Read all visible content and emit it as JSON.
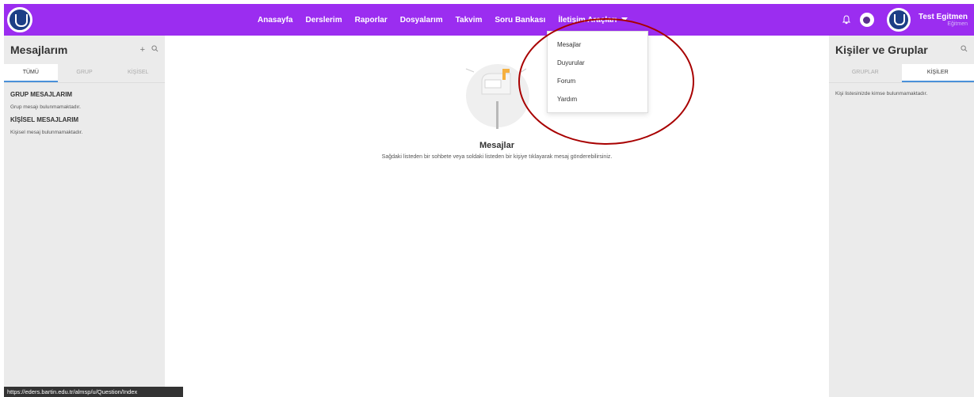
{
  "topbar": {
    "nav": [
      "Anasayfa",
      "Derslerim",
      "Raporlar",
      "Dosyalarım",
      "Takvim",
      "Soru Bankası",
      "İletişim Araçları"
    ],
    "user_name": "Test Egitmen",
    "user_role": "Eğitmen",
    "accent_color": "#9b2df0"
  },
  "left_panel": {
    "title": "Mesajlarım",
    "add_icon": "+",
    "search_icon": "search-icon",
    "tabs": [
      "TÜMÜ",
      "GRUP",
      "KİŞİSEL"
    ],
    "group_heading": "GRUP MESAJLARIM",
    "group_empty": "Grup mesajı bulunmamaktadır.",
    "personal_heading": "KİŞİSEL MESAJLARIM",
    "personal_empty": "Kişisel mesaj bulunmamaktadır."
  },
  "center": {
    "title": "Mesajlar",
    "subtitle": "Sağdaki listeden bir sohbete veya soldaki listeden bir kişiye tıklayarak mesaj gönderebilirsiniz."
  },
  "dropdown": {
    "items": [
      "Mesajlar",
      "Duyurular",
      "Forum",
      "Yardım"
    ]
  },
  "right_panel": {
    "title": "Kişiler ve Gruplar",
    "tabs": [
      "GRUPLAR",
      "KİŞİLER"
    ],
    "empty": "Kişi listesinizde kimse bulunmamaktadır."
  },
  "statusbar": {
    "url": "https://eders.bartin.edu.tr/almsp/u/Question/Index"
  }
}
